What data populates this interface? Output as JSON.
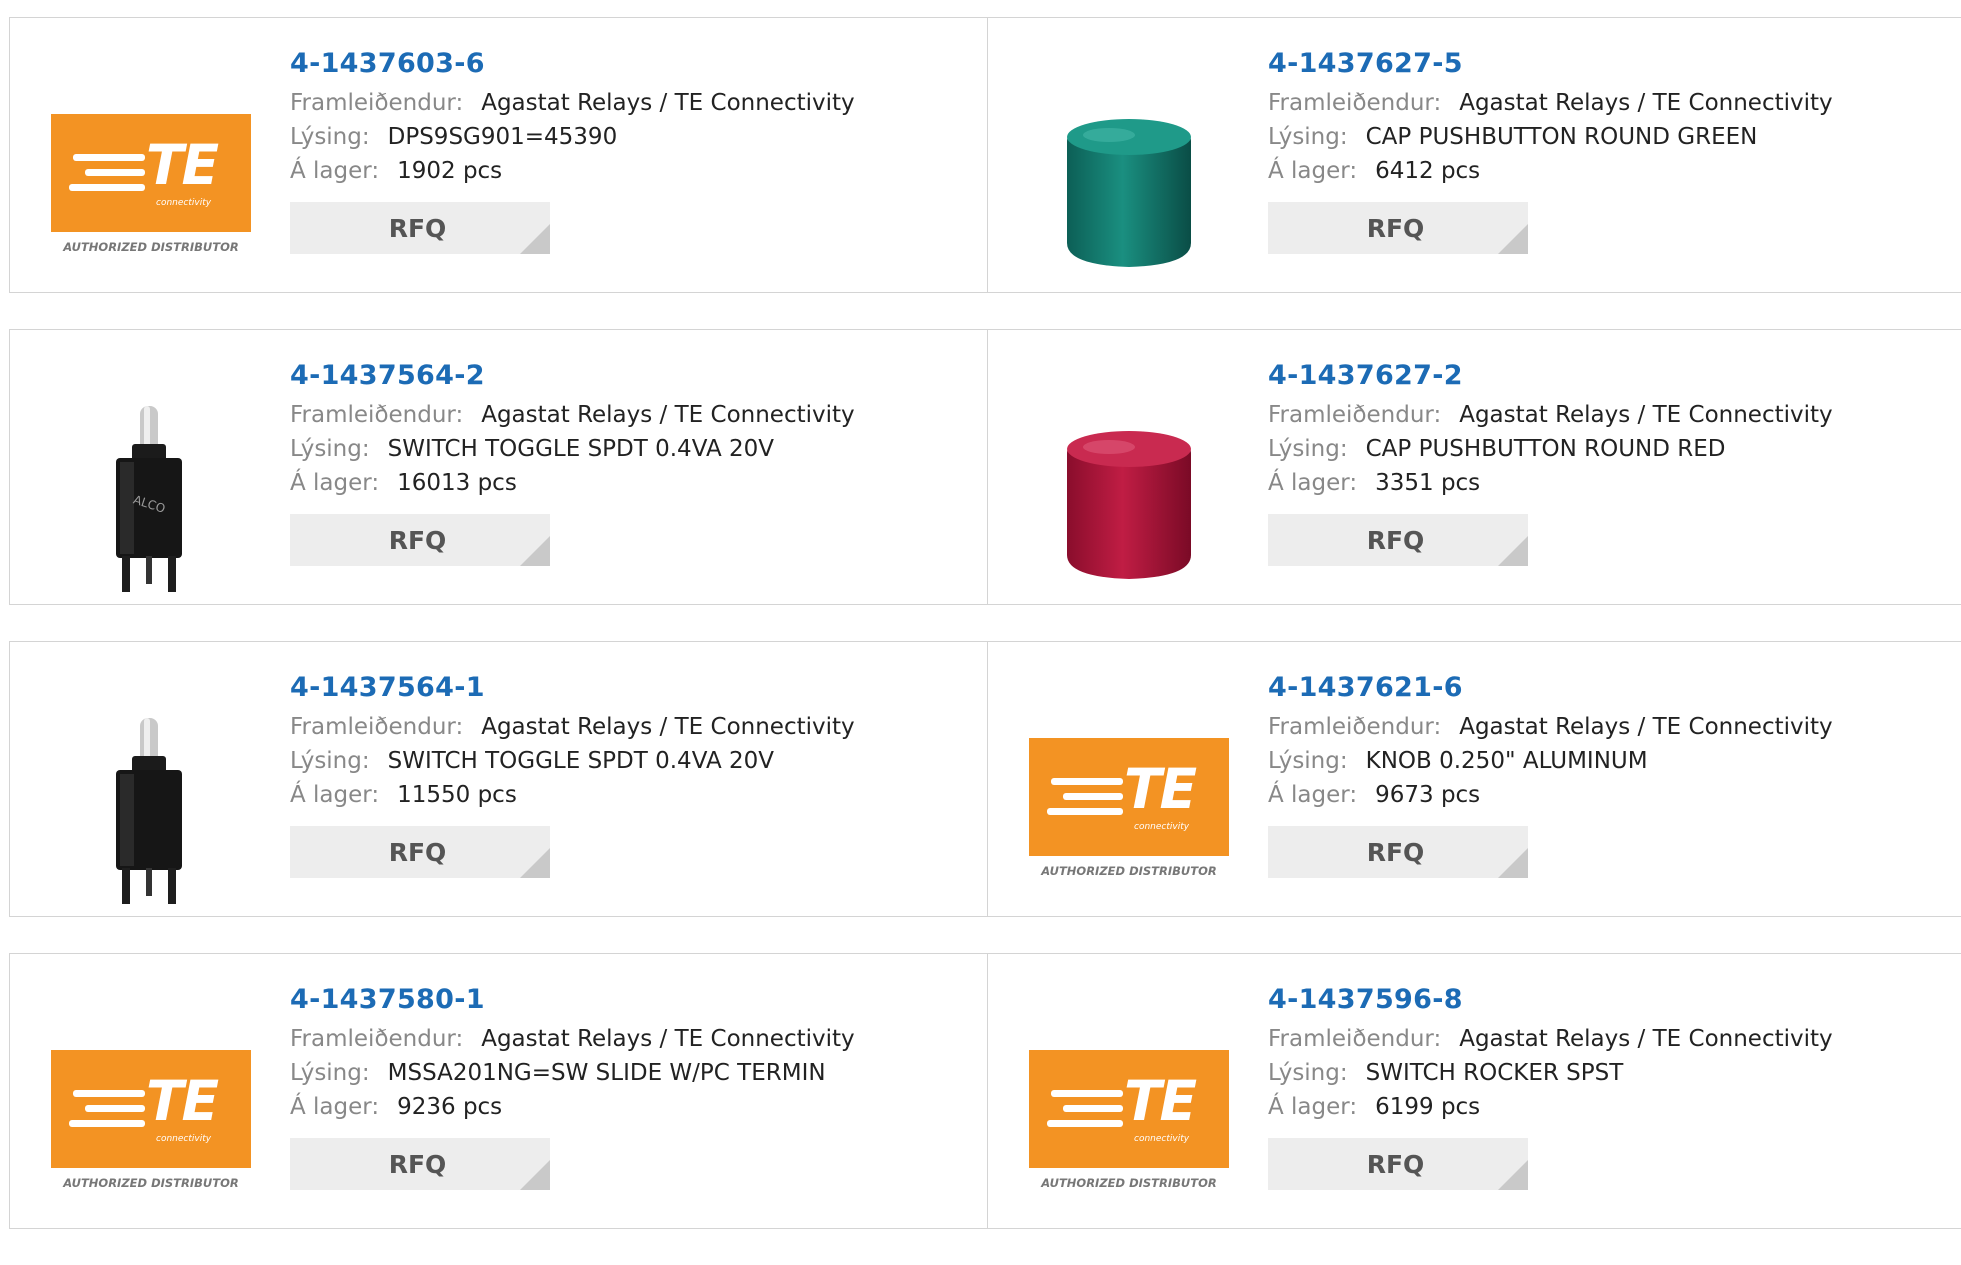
{
  "labels": {
    "manufacturer": "Framleiðendur:",
    "description": "Lýsing:",
    "stock": "Á lager:",
    "rfq": "RFQ"
  },
  "logo": {
    "brand": "TE",
    "tagline": "connectivity",
    "authorized": "AUTHORIZED DISTRIBUTOR",
    "color": "#f39323"
  },
  "products": [
    {
      "part_number": "4-1437603-6",
      "manufacturer": "Agastat Relays / TE Connectivity",
      "description": "DPS9SG901=45390",
      "stock": "1902 pcs",
      "image": "te-logo"
    },
    {
      "part_number": "4-1437627-5",
      "manufacturer": "Agastat Relays / TE Connectivity",
      "description": "CAP PUSHBUTTON ROUND GREEN",
      "stock": "6412 pcs",
      "image": "green-cap"
    },
    {
      "part_number": "4-1437564-2",
      "manufacturer": "Agastat Relays / TE Connectivity",
      "description": "SWITCH TOGGLE SPDT 0.4VA 20V",
      "stock": "16013 pcs",
      "image": "toggle-switch",
      "image_text": "ALCO"
    },
    {
      "part_number": "4-1437627-2",
      "manufacturer": "Agastat Relays / TE Connectivity",
      "description": "CAP PUSHBUTTON ROUND RED",
      "stock": "3351 pcs",
      "image": "red-cap"
    },
    {
      "part_number": "4-1437564-1",
      "manufacturer": "Agastat Relays / TE Connectivity",
      "description": "SWITCH TOGGLE SPDT 0.4VA 20V",
      "stock": "11550 pcs",
      "image": "toggle-switch-plain"
    },
    {
      "part_number": "4-1437621-6",
      "manufacturer": "Agastat Relays / TE Connectivity",
      "description": "KNOB 0.250\" ALUMINUM",
      "stock": "9673 pcs",
      "image": "te-logo"
    },
    {
      "part_number": "4-1437580-1",
      "manufacturer": "Agastat Relays / TE Connectivity",
      "description": "MSSA201NG=SW SLIDE W/PC TERMIN",
      "stock": "9236 pcs",
      "image": "te-logo"
    },
    {
      "part_number": "4-1437596-8",
      "manufacturer": "Agastat Relays / TE Connectivity",
      "description": "SWITCH ROCKER SPST",
      "stock": "6199 pcs",
      "image": "te-logo"
    }
  ]
}
